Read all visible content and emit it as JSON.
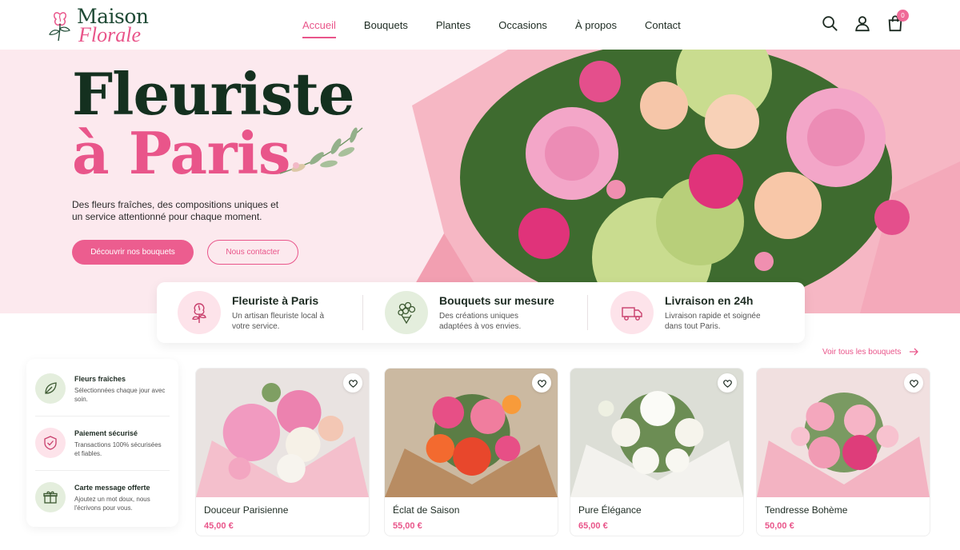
{
  "brand": {
    "line1": "Maison",
    "line2": "Florale"
  },
  "nav": {
    "items": [
      {
        "label": "Accueil",
        "active": true
      },
      {
        "label": "Bouquets"
      },
      {
        "label": "Plantes"
      },
      {
        "label": "Occasions"
      },
      {
        "label": "À propos"
      },
      {
        "label": "Contact"
      }
    ],
    "icons": [
      "search-icon",
      "user-icon",
      "shopping-bag-icon"
    ],
    "cart_count": "0"
  },
  "hero": {
    "title_line1": "Fleuriste",
    "title_line2": "à Paris",
    "subtitle": "Des fleurs fraîches, des compositions uniques et un service attentionné pour chaque moment.",
    "primary_cta": "Découvrir nos bouquets",
    "secondary_cta": "Nous contacter"
  },
  "features": [
    {
      "title": "Fleuriste à Paris",
      "desc": "Un artisan fleuriste local à votre service.",
      "icon": "rose-icon"
    },
    {
      "title": "Bouquets sur mesure",
      "desc": "Des créations uniques adaptées à vos envies.",
      "icon": "bouquet-icon"
    },
    {
      "title": "Livraison en 24h",
      "desc": "Livraison rapide et soignée dans tout Paris.",
      "icon": "delivery-truck-icon"
    }
  ],
  "see_all": "Voir tous les bouquets",
  "perks": [
    {
      "title": "Fleurs fraîches",
      "desc": "Sélectionnées chaque jour avec soin.",
      "icon": "leaf-icon"
    },
    {
      "title": "Paiement sécurisé",
      "desc": "Transactions 100% sécurisées et fiables.",
      "icon": "shield-check-icon"
    },
    {
      "title": "Carte message offerte",
      "desc": "Ajoutez un mot doux, nous l'écrivons pour vous.",
      "icon": "gift-icon"
    }
  ],
  "products": [
    {
      "name": "Douceur Parisienne",
      "price": "45,00 €"
    },
    {
      "name": "Éclat de Saison",
      "price": "55,00 €"
    },
    {
      "name": "Pure Élégance",
      "price": "65,00 €"
    },
    {
      "name": "Tendresse Bohème",
      "price": "50,00 €"
    }
  ],
  "colors": {
    "accent": "#e9558a",
    "dark_green": "#14301f",
    "hero_bg": "#fce9ee"
  }
}
